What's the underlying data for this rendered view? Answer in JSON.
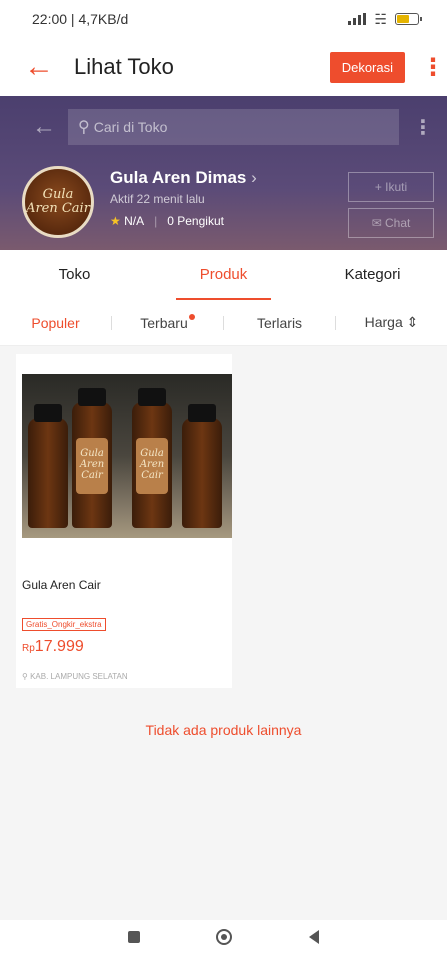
{
  "status_bar": {
    "time": "22:00 | 4,7KB/d",
    "battery_level": 0.6
  },
  "app_bar": {
    "title": "Lihat Toko",
    "decorate_label": "Dekorasi"
  },
  "search": {
    "placeholder": "Cari di Toko"
  },
  "shop": {
    "avatar_text": "Gula Aren Cair",
    "name": "Gula Aren Dimas",
    "active": "Aktif 22 menit lalu",
    "rating": "N/A",
    "followers": "0 Pengikut",
    "follow_label": "+ Ikuti",
    "chat_label": "Chat"
  },
  "tabs": [
    {
      "label": "Toko"
    },
    {
      "label": "Produk"
    },
    {
      "label": "Kategori"
    }
  ],
  "sort": [
    {
      "label": "Populer"
    },
    {
      "label": "Terbaru"
    },
    {
      "label": "Terlaris"
    },
    {
      "label": "Harga"
    }
  ],
  "product": {
    "image_text": "Gula Aren Cair",
    "name": "Gula Aren Cair",
    "promo_tag": "Gratis_Ongkir_ekstra",
    "price_currency": "Rp",
    "price_value": "17.999",
    "location": "KAB. LAMPUNG SELATAN"
  },
  "no_more_text": "Tidak ada produk lainnya",
  "colors": {
    "accent": "#ee4d2d",
    "header_bg": "#4b3f6e"
  }
}
